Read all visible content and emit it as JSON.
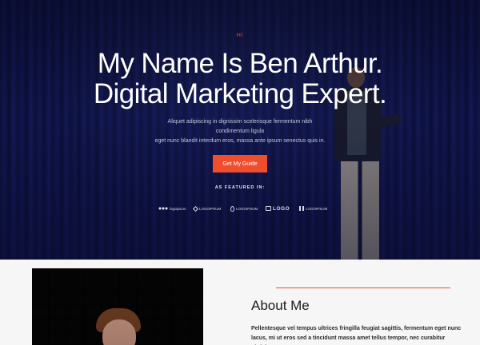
{
  "hero": {
    "greeting": "Hi",
    "headline_line1": "My Name Is Ben Arthur.",
    "headline_line2": "Digital Marketing Expert.",
    "subtext_line1": "Aliquet adipiscing in dignissim scelerisque fermentum nibh",
    "subtext_line2": "condimentum ligula",
    "subtext_line3": "eget nunc blandit interdum eros, massa ante ipsum senectus quis in.",
    "cta_label": "Get My Guide",
    "featured_label": "AS FEATURED IN:"
  },
  "featured_logos": [
    {
      "icon": "dots-logo-icon",
      "text": "logoipsum"
    },
    {
      "icon": "diamond-logo-icon",
      "text": "LOGOIPSUM"
    },
    {
      "icon": "drop-logo-icon",
      "text": "LOGOIPSUM"
    },
    {
      "icon": "bracket-logo-icon",
      "text": "LOGO"
    },
    {
      "icon": "bars-logo-icon",
      "text": "LOGOIPSUM"
    }
  ],
  "about": {
    "title": "About Me",
    "paragraph": "Pellentesque vel tempus ultrices fringilla feugiat sagittis, fermentum eget nunc lacus, mi ut eros sed a tincidunt massa amet tellus tempor, nec curabitur ultricies."
  },
  "colors": {
    "accent": "#ee4e2d",
    "hero_bg": "#10154a",
    "section_bg": "#f6f6f6"
  }
}
